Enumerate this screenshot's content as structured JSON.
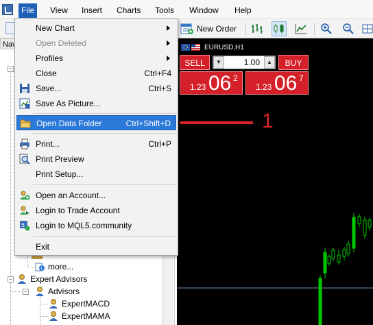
{
  "menubar": {
    "items": [
      {
        "label": "File",
        "active": true
      },
      {
        "label": "View"
      },
      {
        "label": "Insert"
      },
      {
        "label": "Charts"
      },
      {
        "label": "Tools"
      },
      {
        "label": "Window"
      },
      {
        "label": "Help"
      }
    ]
  },
  "toolbar": {
    "new_order_label": "New Order",
    "buttons": [
      "bar-chart-icon",
      "candlestick-chart-icon",
      "line-chart-icon",
      "zoom-in-icon",
      "zoom-out-icon"
    ]
  },
  "navigator": {
    "tab_label": "Nav",
    "tree": [
      {
        "label": "more...",
        "level": 3
      },
      {
        "label": "Expert Advisors",
        "level": 1
      },
      {
        "label": "Advisors",
        "level": 2
      },
      {
        "label": "ExpertMACD",
        "level": 3
      },
      {
        "label": "ExpertMAMA",
        "level": 3
      }
    ]
  },
  "file_menu": {
    "items": [
      {
        "label": "New Chart",
        "submenu": true,
        "icon": ""
      },
      {
        "label": "Open Deleted",
        "submenu": true,
        "disabled": true,
        "icon": ""
      },
      {
        "label": "Profiles",
        "submenu": true,
        "icon": ""
      },
      {
        "label": "Close",
        "shortcut": "Ctrl+F4",
        "icon": ""
      },
      {
        "label": "Save...",
        "shortcut": "Ctrl+S",
        "icon": "save-icon"
      },
      {
        "label": "Save As Picture...",
        "icon": "save-picture-icon"
      },
      {
        "label": "Open Data Folder",
        "shortcut": "Ctrl+Shift+D",
        "highlighted": true,
        "icon": "folder-icon"
      },
      {
        "label": "Print...",
        "shortcut": "Ctrl+P",
        "icon": "print-icon"
      },
      {
        "label": "Print Preview",
        "icon": "print-preview-icon"
      },
      {
        "label": "Print Setup...",
        "icon": ""
      },
      {
        "label": "Open an Account...",
        "icon": "account-icon"
      },
      {
        "label": "Login to Trade Account",
        "icon": "login-icon"
      },
      {
        "label": "Login to MQL5.community",
        "icon": "mql5-icon"
      },
      {
        "label": "Exit",
        "icon": ""
      }
    ]
  },
  "chart": {
    "symbol": "EURUSD,H1",
    "sell_label": "SELL",
    "buy_label": "BUY",
    "lot": "1.00",
    "sell_price": {
      "prefix": "1.23",
      "big": "06",
      "sup": "2"
    },
    "buy_price": {
      "prefix": "1.23",
      "big": "06",
      "sup": "7"
    }
  },
  "annotation": {
    "number": "1"
  },
  "colors": {
    "highlight": "#2b79d8",
    "trade_red": "#d42129",
    "annotation_red": "#d8232a",
    "chart_bg": "#000000",
    "candle_green": "#00c800"
  }
}
